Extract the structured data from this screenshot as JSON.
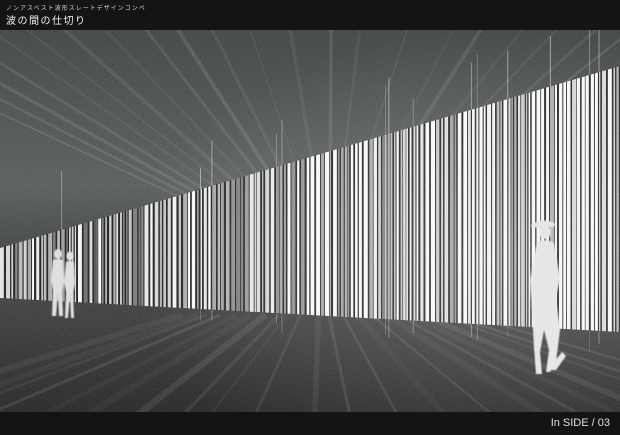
{
  "header": {
    "subtitle": "ノンアスベスト波形スレートデザインコンペ",
    "title": "波の間の仕切り"
  },
  "footer": {
    "page_label": "In SIDE / 03"
  }
}
